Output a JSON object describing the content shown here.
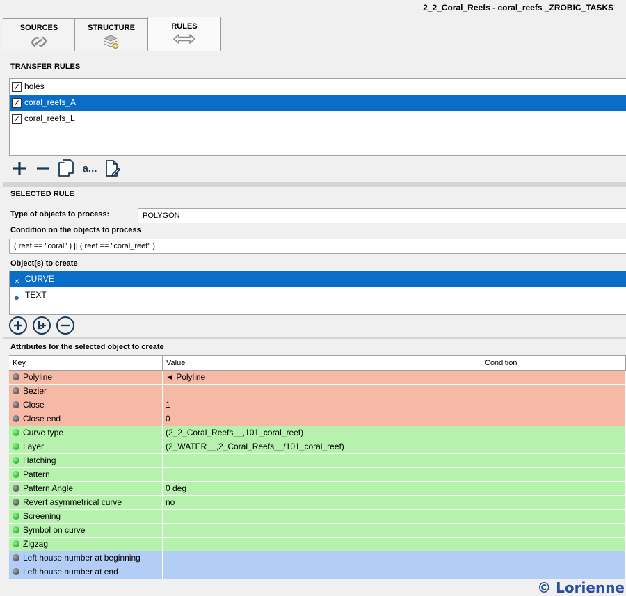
{
  "window": {
    "title": "2_2_Coral_Reefs - coral_reefs _ZROBIC_TASKS"
  },
  "tabs": [
    {
      "label": "SOURCES",
      "icon": "link-icon"
    },
    {
      "label": "STRUCTURE",
      "icon": "layers-gear-icon"
    },
    {
      "label": "RULES",
      "icon": "double-arrow-icon",
      "active": true
    }
  ],
  "transfer_rules": {
    "title": "TRANSFER RULES",
    "items": [
      {
        "label": "holes",
        "checked": true,
        "selected": false
      },
      {
        "label": "coral_reefs_A",
        "checked": true,
        "selected": true
      },
      {
        "label": "coral_reefs_L",
        "checked": true,
        "selected": false
      }
    ],
    "toolbar": {
      "more_label": "a..."
    }
  },
  "selected_rule": {
    "title": "SELECTED RULE",
    "type_label": "Type of objects to process:",
    "type_value": "POLYGON",
    "condition_label": "Condition on the objects to process",
    "condition_value": "( reef == \"coral\" ) || ( reef == \"coral_reef\" )",
    "objects_label": "Object(s) to create",
    "objects": [
      {
        "label": "CURVE",
        "selected": true
      },
      {
        "label": "TEXT",
        "selected": false
      }
    ]
  },
  "attributes": {
    "title": "Attributes for the selected object to create",
    "headers": {
      "key": "Key",
      "value": "Value",
      "condition": "Condition"
    },
    "rows": [
      {
        "key": "Polyline",
        "value": "◄ Polyline",
        "condition": "",
        "color": "red",
        "dot": "gray"
      },
      {
        "key": "Bezier",
        "value": "",
        "condition": "",
        "color": "red",
        "dot": "gray"
      },
      {
        "key": "Close",
        "value": "1",
        "condition": "",
        "color": "red",
        "dot": "gray"
      },
      {
        "key": "Close end",
        "value": "0",
        "condition": "",
        "color": "red",
        "dot": "gray"
      },
      {
        "key": "Curve type",
        "value": "(2_2_Coral_Reefs__,101_coral_reef)",
        "condition": "",
        "color": "green",
        "dot": "green"
      },
      {
        "key": "Layer",
        "value": "(2_WATER__,2_Coral_Reefs__/101_coral_reef)",
        "condition": "",
        "color": "green",
        "dot": "green"
      },
      {
        "key": "Hatching",
        "value": "",
        "condition": "",
        "color": "green",
        "dot": "green"
      },
      {
        "key": "Pattern",
        "value": "",
        "condition": "",
        "color": "green",
        "dot": "green"
      },
      {
        "key": "Pattern Angle",
        "value": "0 deg",
        "condition": "",
        "color": "green",
        "dot": "gray"
      },
      {
        "key": "Revert asymmetrical curve",
        "value": "no",
        "condition": "",
        "color": "green",
        "dot": "gray"
      },
      {
        "key": "Screening",
        "value": "",
        "condition": "",
        "color": "green",
        "dot": "green"
      },
      {
        "key": "Symbol on curve",
        "value": "",
        "condition": "",
        "color": "green",
        "dot": "green"
      },
      {
        "key": "Zigzag",
        "value": "",
        "condition": "",
        "color": "green",
        "dot": "green"
      },
      {
        "key": "Left house number at beginning",
        "value": "",
        "condition": "",
        "color": "blue",
        "dot": "gray"
      },
      {
        "key": "Left house number at end",
        "value": "",
        "condition": "",
        "color": "blue",
        "dot": "gray"
      }
    ]
  },
  "watermark": "© Lorienne",
  "colors": {
    "selection": "#0a6ec9",
    "row_red": "#f6b9a6",
    "row_green": "#b6f2ad",
    "row_blue": "#b2cdf6"
  }
}
